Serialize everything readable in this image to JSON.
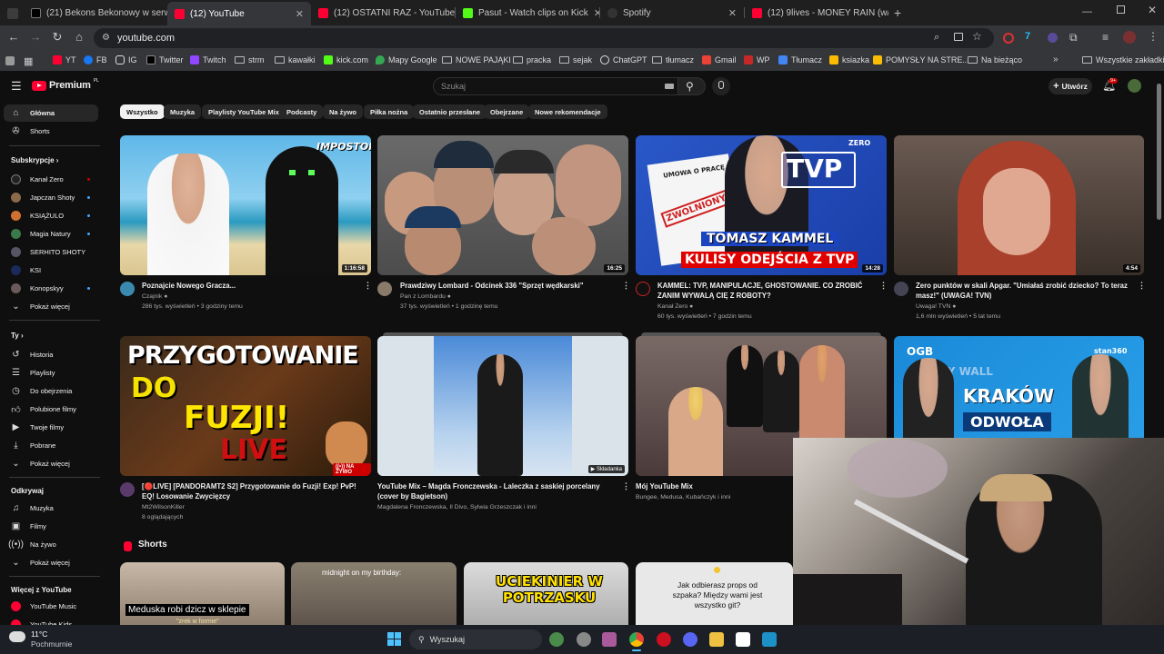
{
  "browser": {
    "tabs": [
      {
        "label": "(21) Bekons Bekonowy w serwis",
        "color": "#e0e0e0"
      },
      {
        "label": "(12) YouTube",
        "color": "#ff0033"
      },
      {
        "label": "(12) OSTATNI RAZ - YouTube",
        "color": "#ff0033"
      },
      {
        "label": "Pasut - Watch clips on Kick",
        "color": "#53fc18"
      },
      {
        "label": "Spotify",
        "color": "#333333"
      },
      {
        "label": "(12) 9lives - MONEY RAIN (w/ S",
        "color": "#ff0033"
      }
    ],
    "url": "youtube.com",
    "bookmarks": [
      "YT",
      "FB",
      "IG",
      "Twitter",
      "Twitch",
      "strm",
      "kawałki",
      "kick.com",
      "Mapy Google",
      "NOWE PAJĄKI",
      "pracka",
      "sejak",
      "ChatGPT",
      "tłumacz",
      "Gmail",
      "WP",
      "Tłumacz",
      "ksiazka",
      "POMYSŁY NA STRE...",
      "Na bieżąco"
    ],
    "all_bookmarks": "Wszystkie zakładki"
  },
  "yt": {
    "logo": "Premium",
    "logo_sup": "PL",
    "search_placeholder": "Szukaj",
    "create": "Utwórz",
    "notif_count": "9+",
    "chips": [
      "Wszystko",
      "Muzyka",
      "Playlisty YouTube Mix",
      "Podcasty",
      "Na żywo",
      "Piłka nożna",
      "Ostatnio przesłane",
      "Obejrzane",
      "Nowe rekomendacje"
    ]
  },
  "sidebar": {
    "main": [
      "Główna",
      "Shorts"
    ],
    "subs_head": "Subskrypcje",
    "subs": [
      "Kanał Zero",
      "Japczan Shoty",
      "KSIĄŻULO",
      "Magia Natury",
      "SERHITO SHOTY",
      "KSI",
      "Konopskyy"
    ],
    "show_more": "Pokaż więcej",
    "you_head": "Ty",
    "you": [
      "Historia",
      "Playlisty",
      "Do obejrzenia",
      "Polubione filmy",
      "Twoje filmy",
      "Pobrane"
    ],
    "explore_head": "Odkrywaj",
    "explore": [
      "Muzyka",
      "Filmy",
      "Na żywo"
    ],
    "more_head": "Więcej z YouTube",
    "more": [
      "YouTube Music",
      "YouTube Kids"
    ]
  },
  "videos": [
    {
      "title": "Poznajcie Nowego Gracza...",
      "channel": "Czajnik",
      "meta": "286 tys. wyświetleń • 3 godziny temu",
      "duration": "1:16:58",
      "thumb_text": "IMPOSTOR"
    },
    {
      "title": "Prawdziwy Lombard - Odcinek 336 \"Sprzęt wędkarski\"",
      "channel": "Pan z Lombardu",
      "meta": "37 tys. wyświetleń • 1 godzinę temu",
      "duration": "16:25",
      "thumb_text": ""
    },
    {
      "title": "KAMMEL: TVP, MANIPULACJE, GHOSTOWANIE. CO ZROBIĆ ZANIM WYWALĄ CIĘ Z ROBOTY?",
      "channel": "Kanał Zero",
      "meta": "60 tys. wyświetleń • 7 godzin temu",
      "duration": "14:28",
      "thumb_text": "TOMASZ KAMMEL",
      "thumb_text2": "KULISY ODEJŚCIA Z TVP",
      "thumb_text3": "TVP",
      "thumb_text4": "ZWOLNIONY",
      "thumb_text5": "UMOWA O PRACĘ",
      "thumb_text6": "ZERO"
    },
    {
      "title": "Zero punktów w skali Apgar. \"Umiałaś zrobić dziecko? To teraz masz!\" (UWAGA! TVN)",
      "channel": "Uwaga! TVN",
      "meta": "1,6 mln wyświetleń • 5 lat temu",
      "duration": "4:54",
      "thumb_text": ""
    },
    {
      "title": "[🔴LIVE] [PANDORAMT2 S2] Przygotowanie do Fuzji! Exp! PvP! EQ! Losowanie Zwycięzcy",
      "channel": "Mt2WilsonKiller",
      "meta": "8 oglądających",
      "duration": "",
      "thumb_text": "PRZYGOTOWANIE",
      "thumb_text2": "DO",
      "thumb_text3": "FUZJI!",
      "thumb_text4": "LIVE",
      "badge": "NA ŻYWO"
    },
    {
      "title": "YouTube Mix – Magda Fronczewska - Laleczka z saskiej porcelany (cover by Bagietson)",
      "channel": "Magdalena Fronczewska, Il Divo, Sylwia Grzeszczak i inni",
      "meta": "",
      "duration": "",
      "badge": "Składanka"
    },
    {
      "title": "Mój YouTube Mix",
      "channel": "Bungee, Medusa, Kubańczyk i inni",
      "meta": "",
      "duration": ""
    },
    {
      "title": "",
      "channel": "",
      "meta": "",
      "duration": "",
      "thumb_text": "KRAKÓW",
      "thumb_text2": "ODWOŁA",
      "thumb_text3": "OGB",
      "thumb_text4": "stan360",
      "thumb_text5": "ORY WALL"
    }
  ],
  "shorts": {
    "head": "Shorts",
    "items": [
      {
        "caption": "Meduska robi dzicz w sklepie",
        "sub": "\"zrek w formie\""
      },
      {
        "caption": "midnight on my birthday:"
      },
      {
        "caption": "UCIEKINIER W POTRZASKU"
      },
      {
        "caption": "Jak odbierasz props od szpaka? Między wami jest wszystko git?"
      }
    ]
  },
  "taskbar": {
    "weather_temp": "11°C",
    "weather_desc": "Pochmurnie",
    "search": "Wyszukaj"
  }
}
